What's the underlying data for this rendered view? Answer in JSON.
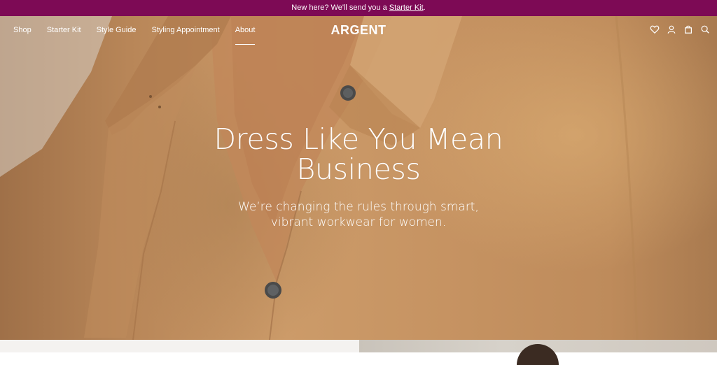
{
  "announcement": {
    "prefix": "New here? We'll send you a ",
    "link": "Starter Kit",
    "suffix": "."
  },
  "nav": {
    "links": [
      "Shop",
      "Starter Kit",
      "Style Guide",
      "Styling Appointment",
      "About"
    ],
    "active": "About",
    "logo": "ARGENT",
    "icons": [
      "heart-icon",
      "user-icon",
      "bag-icon",
      "search-icon"
    ]
  },
  "hero": {
    "headline": "Dress Like You Mean Business",
    "subheadline": "We’re changing the rules through smart, vibrant workwear for women."
  },
  "colors": {
    "announcement_bg": "#7d0a55",
    "shirt": "#c6955f",
    "text": "#ffffff"
  }
}
